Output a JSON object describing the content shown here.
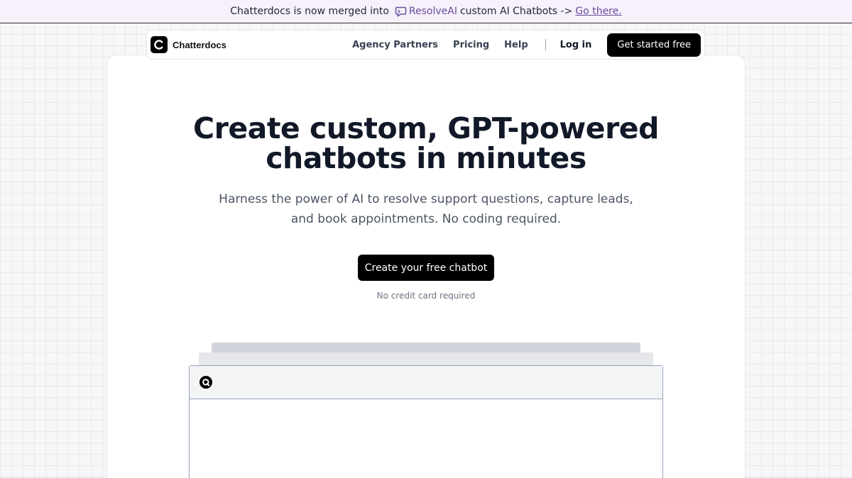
{
  "announcement": {
    "prefix": "Chatterdocs is now merged into",
    "brand": "ResolveAI",
    "suffix": "custom AI Chatbots ->",
    "link": "Go there."
  },
  "nav": {
    "logo_text": "Chatterdocs",
    "links": [
      "Agency Partners",
      "Pricing",
      "Help"
    ],
    "login": "Log in",
    "cta": "Get started free"
  },
  "hero": {
    "title_line1": "Create custom, GPT-powered",
    "title_line2": "chatbots in minutes",
    "subtitle_line1": "Harness the power of AI to resolve support questions, capture leads,",
    "subtitle_line2": "and book appointments. No coding required.",
    "cta": "Create your free chatbot",
    "note": "No credit card required"
  },
  "colors": {
    "accent_purple": "#6b4e9b",
    "primary": "#000000",
    "announce_bg": "#f6f1fb"
  },
  "icons": {
    "brand": "chat-bubble-icon",
    "logo": "c-logo-icon",
    "preview": "chatbot-logo-icon"
  }
}
